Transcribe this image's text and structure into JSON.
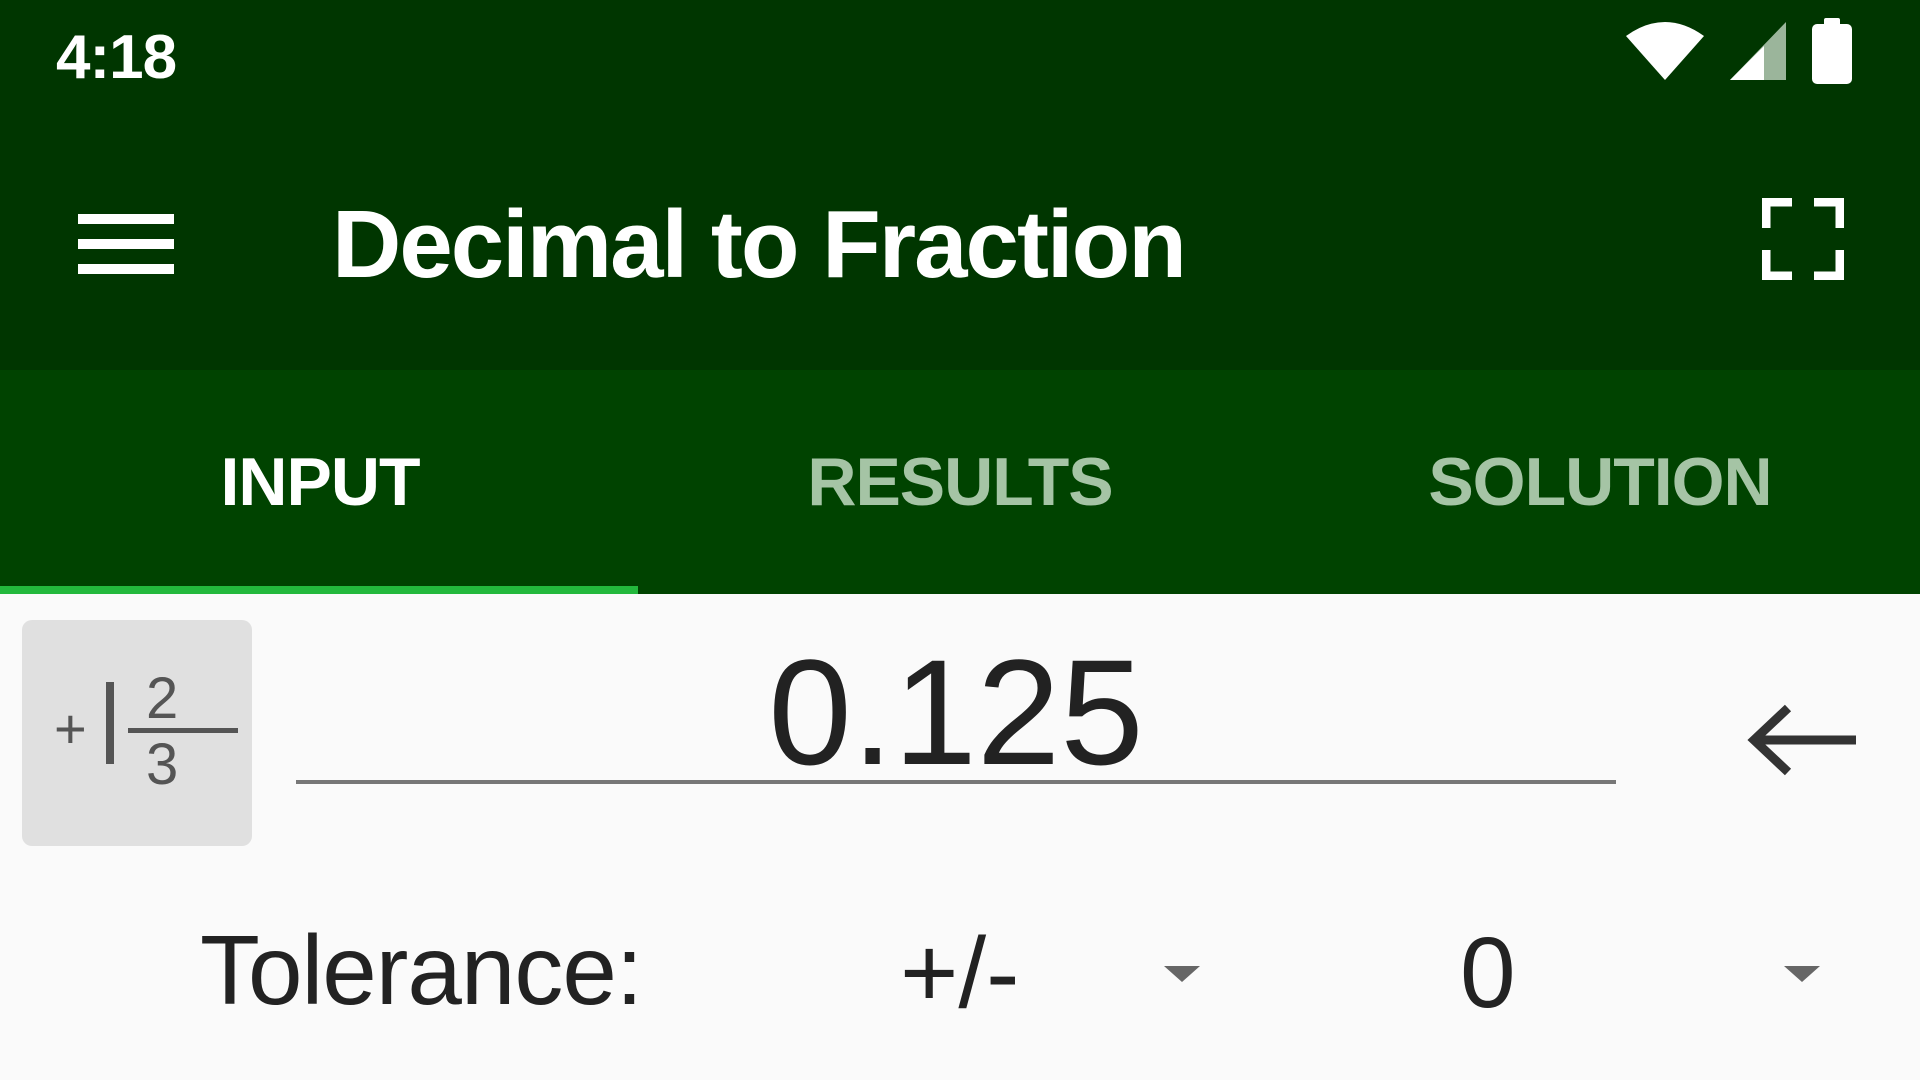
{
  "status_bar": {
    "time": "4:18",
    "icons": [
      "wifi-icon",
      "cellular-signal-icon",
      "battery-icon"
    ]
  },
  "app_bar": {
    "menu_icon": "hamburger-menu-icon",
    "title": "Decimal to Fraction",
    "fullscreen_icon": "fullscreen-icon"
  },
  "tabs": [
    {
      "label": "INPUT",
      "active": true
    },
    {
      "label": "RESULTS",
      "active": false
    },
    {
      "label": "SOLUTION",
      "active": false
    }
  ],
  "input": {
    "fraction_button_icon": "mixed-fraction-icon",
    "fraction_button_text": {
      "sign": "+",
      "numerator": "2",
      "denominator": "3"
    },
    "decimal_value": "0.125",
    "backspace_icon": "backspace-arrow-icon"
  },
  "tolerance": {
    "label": "Tolerance:",
    "sign_selected": "+/-",
    "value_selected": "0"
  },
  "colors": {
    "app_bar": "#003600",
    "tab_bar": "#004300",
    "tab_indicator": "#23b83c",
    "tab_inactive_text": "#a5c4a5",
    "background": "#fafafa"
  }
}
